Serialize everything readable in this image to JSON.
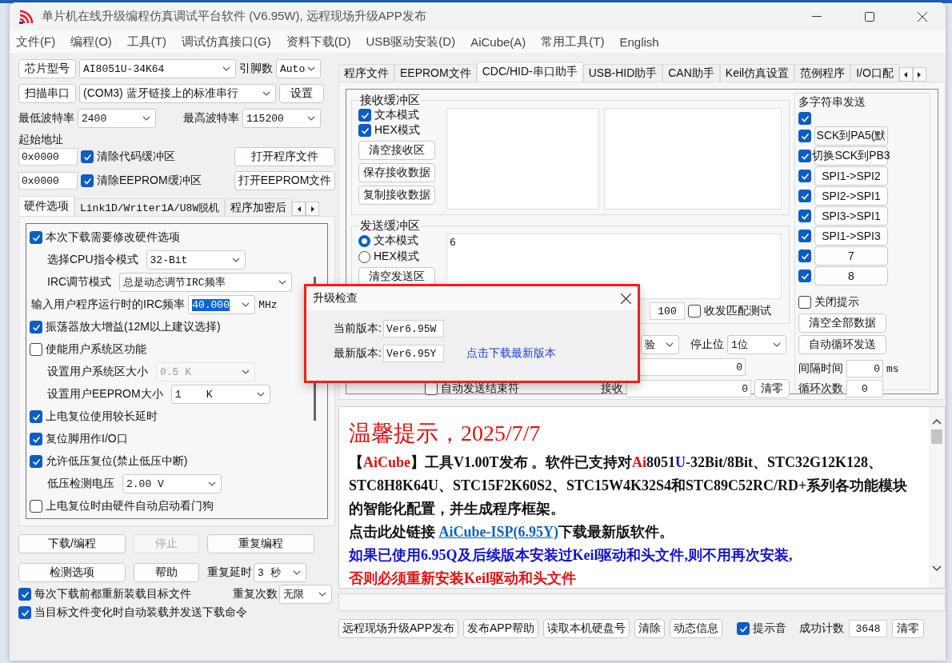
{
  "window": {
    "title": "单片机在线升级编程仿真调试平台软件 (V6.95W), 远程现场升级APP发布"
  },
  "menu": [
    "文件(F)",
    "编程(O)",
    "工具(T)",
    "调试仿真接口(G)",
    "资料下载(D)",
    "USB驱动安装(D)",
    "AiCube(A)",
    "常用工具(T)",
    "English"
  ],
  "left": {
    "chip_button": "芯片型号",
    "chip": "AI8051U-34K64",
    "pins_label": "引脚数",
    "pins": "Auto",
    "port_button": "扫描串口",
    "port": "(COM3) 蓝牙链接上的标准串行",
    "settings_button": "设置",
    "min_baud_label": "最低波特率",
    "min_baud": "2400",
    "max_baud_label": "最高波特率",
    "max_baud": "115200",
    "address_label": "起始地址",
    "files": [
      {
        "address": "0x0000",
        "label": "清除代码缓冲区",
        "checked": true,
        "button": "打开程序文件"
      },
      {
        "address": "0x0000",
        "label": "清除EEPROM缓冲区",
        "checked": true,
        "button": "打开EEPROM文件"
      }
    ],
    "tabs": [
      {
        "label": "硬件选项",
        "selected": true
      },
      {
        "label": "Link1D/Writer1A/U8W脱机",
        "selected": false
      },
      {
        "label": "程序加密后",
        "selected": false
      }
    ],
    "options": [
      {
        "kind": "check",
        "label": "本次下载需要修改硬件选项",
        "checked": true
      },
      {
        "kind": "select",
        "label": "选择CPU指令模式",
        "value": "32-Bit",
        "disabled": false
      },
      {
        "kind": "select",
        "label": "IRC调节模式",
        "value": "总是动态调节IRC频率",
        "disabled": false
      },
      {
        "kind": "freq",
        "label": "输入用户程序运行时的IRC频率",
        "value": "40.000",
        "unit": "MHz"
      },
      {
        "kind": "check",
        "label": "振荡器放大增益(12M以上建议选择)",
        "checked": true
      },
      {
        "kind": "check",
        "label": "使能用户系统区功能",
        "checked": false
      },
      {
        "kind": "select",
        "label": "设置用户系统区大小",
        "value": "0.5 K",
        "disabled": true
      },
      {
        "kind": "select",
        "label": "设置用户EEPROM大小",
        "value": "1    K",
        "disabled": false
      },
      {
        "kind": "check",
        "label": "上电复位使用较长延时",
        "checked": true
      },
      {
        "kind": "check",
        "label": "复位脚用作I/O口",
        "checked": true
      },
      {
        "kind": "check",
        "label": "允许低压复位(禁止低压中断)",
        "checked": true
      },
      {
        "kind": "select",
        "label": "低压检测电压",
        "value": "2.00 V",
        "disabled": false
      },
      {
        "kind": "check",
        "label": "上电复位时由硬件自动启动看门狗",
        "checked": false
      }
    ],
    "actions": [
      {
        "label": "下载/编程",
        "disabled": false
      },
      {
        "label": "停止",
        "disabled": true
      },
      {
        "label": "重复编程",
        "disabled": false
      },
      {
        "label": "检测选项",
        "disabled": false
      },
      {
        "label": "帮助",
        "disabled": false
      }
    ],
    "repeat_delay_label": "重复延时",
    "repeat_delay": "3 秒",
    "repeat_count_label": "重复次数",
    "repeat_count": "无限",
    "auto_checks": [
      {
        "label": "每次下载前都重新装载目标文件",
        "checked": true
      },
      {
        "label": "当目标文件变化时自动装载并发送下载命令",
        "checked": true
      }
    ]
  },
  "right": {
    "tabs": [
      {
        "label": "程序文件",
        "selected": false
      },
      {
        "label": "EEPROM文件",
        "selected": false
      },
      {
        "label": "CDC/HID-串口助手",
        "selected": true
      },
      {
        "label": "USB-HID助手",
        "selected": false
      },
      {
        "label": "CAN助手",
        "selected": false
      },
      {
        "label": "Keil仿真设置",
        "selected": false
      },
      {
        "label": "范例程序",
        "selected": false
      },
      {
        "label": "I/O口配",
        "selected": false
      }
    ],
    "receive": {
      "title": "接收缓冲区",
      "modes": [
        {
          "label": "文本模式",
          "checked": true
        },
        {
          "label": "HEX模式",
          "checked": true
        }
      ],
      "buttons": [
        "清空接收区",
        "保存接收数据",
        "复制接收数据"
      ]
    },
    "send": {
      "title": "发送缓冲区",
      "modes": [
        {
          "label": "文本模式",
          "selected": true
        },
        {
          "label": "HEX模式",
          "selected": false
        }
      ],
      "button": "清空发送区",
      "value": "6",
      "interval": "100",
      "match_test": {
        "label": "收发匹配测试",
        "checked": false
      },
      "auto_end": {
        "label": "自动发送结束符",
        "checked": false
      }
    },
    "port_settings": {
      "parity": "验",
      "stop_label": "停止位",
      "stop": "1位",
      "sent": "0",
      "received_label": "接收",
      "received": "0",
      "reset_button": "清零"
    },
    "multi": {
      "title": "多字符串发送",
      "items": [
        {
          "checked": true
        },
        {
          "checked": true,
          "button": "SCK到PA5(默"
        },
        {
          "checked": true,
          "button": "切换SCK到PB3"
        },
        {
          "checked": true,
          "button": "SPI1->SPI2"
        },
        {
          "checked": true,
          "button": "SPI2->SPI1"
        },
        {
          "checked": true,
          "button": "SPI3->SPI1"
        },
        {
          "checked": true,
          "button": "SPI1->SPI3"
        },
        {
          "checked": true,
          "button": "7"
        },
        {
          "checked": true,
          "button": "8"
        }
      ],
      "close_hint": {
        "label": "关闭提示",
        "checked": false
      },
      "buttons": [
        "清空全部数据",
        "自动循环发送"
      ],
      "interval_label": "间隔时间",
      "interval": "0",
      "interval_unit": "ms",
      "loop_label": "循环次数",
      "loop": "0"
    }
  },
  "notice": {
    "heading": "温馨提示，2025/7/7",
    "paragraphs": [
      [
        {
          "kind": "text",
          "text": "【",
          "color": "#111111"
        },
        {
          "kind": "text",
          "text": "AiCube",
          "color": "#e01010"
        },
        {
          "kind": "text",
          "text": "】工具V1.00T发布 。软件已支持对",
          "color": "#111111"
        },
        {
          "kind": "text",
          "text": "Ai",
          "color": "#e01010"
        },
        {
          "kind": "text",
          "text": "8051",
          "color": "#111111"
        },
        {
          "kind": "text",
          "text": "U",
          "color": "#1010d0"
        },
        {
          "kind": "text",
          "text": "-32Bit/8Bit、STC32G12K128、STC8H8K64U、STC15F2K60S2、STC15W4K32S4和STC89C52RC/RD+系列各功能模块的智能化配置，并生成程序框架。",
          "color": "#111111"
        }
      ],
      [
        {
          "kind": "text",
          "text": "点击此处链接 ",
          "color": "#111111"
        },
        {
          "kind": "link",
          "text": "AiCube-ISP(6.95Y)"
        },
        {
          "kind": "text",
          "text": "下载最新版软件。",
          "color": "#111111"
        }
      ],
      [
        {
          "kind": "text",
          "text": "如果已使用6.95Q及后续版本安装过Keil驱动和头文件,则不用再次安装,",
          "color": "#1010d0"
        }
      ],
      [
        {
          "kind": "text",
          "text": "否则必须重新安装Keil驱动和头文件",
          "color": "#e01010"
        }
      ]
    ]
  },
  "bottom": {
    "buttons": [
      "远程现场升级APP发布",
      "发布APP帮助",
      "读取本机硬盘号",
      "清除",
      "动态信息"
    ],
    "sound": {
      "label": "提示音",
      "checked": true
    },
    "count_label": "成功计数",
    "count": "3648",
    "reset_button": "清零"
  },
  "dialog": {
    "title": "升级检查",
    "rows": [
      {
        "label": "当前版本:",
        "value": "Ver6.95W"
      },
      {
        "label": "最新版本:",
        "value": "Ver6.95Y"
      }
    ],
    "link": "点击下载最新版本"
  }
}
